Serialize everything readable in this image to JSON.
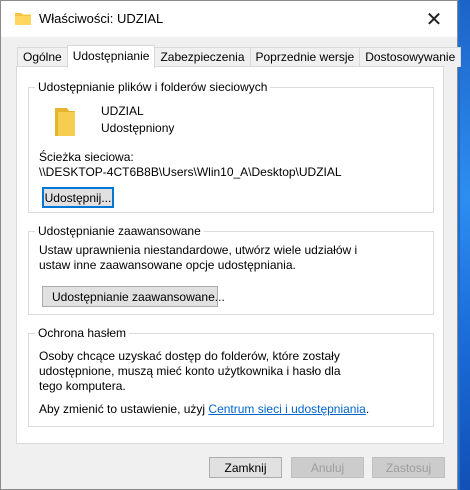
{
  "window": {
    "title": "Właściwości: UDZIAL",
    "close_glyph": "✕"
  },
  "tabs": [
    {
      "label": "Ogólne",
      "active": false
    },
    {
      "label": "Udostępnianie",
      "active": true
    },
    {
      "label": "Zabezpieczenia",
      "active": false
    },
    {
      "label": "Poprzednie wersje",
      "active": false
    },
    {
      "label": "Dostosowywanie",
      "active": false
    }
  ],
  "sharing": {
    "group_title": "Udostępnianie plików i folderów sieciowych",
    "folder_name": "UDZIAL",
    "folder_status": "Udostępniony",
    "path_label": "Ścieżka sieciowa:",
    "path_value": "\\\\DESKTOP-4CT6B8B\\Users\\Wlin10_A\\Desktop\\UDZIAL",
    "share_button": "Udostępnij..."
  },
  "advanced": {
    "group_title": "Udostępnianie zaawansowane",
    "description": "Ustaw uprawnienia niestandardowe, utwórz wiele udziałów i ustaw inne zaawansowane opcje udostępniania.",
    "button": "Udostępnianie zaawansowane..."
  },
  "password": {
    "group_title": "Ochrona hasłem",
    "description": "Osoby chcące uzyskać dostęp do folderów, które zostały udostępnione, muszą mieć konto użytkownika i hasło dla tego komputera.",
    "change_prefix": "Aby zmienić to ustawienie, użyj ",
    "link": "Centrum sieci i udostępniania",
    "change_suffix": "."
  },
  "footer": {
    "close": "Zamknij",
    "cancel": "Anuluj",
    "apply": "Zastosuj"
  },
  "colors": {
    "folder": "#f4c542",
    "link": "#0066cc",
    "focus": "#0078d7"
  },
  "icons": [
    "folder-icon",
    "close-icon",
    "uac-shield-icon"
  ]
}
